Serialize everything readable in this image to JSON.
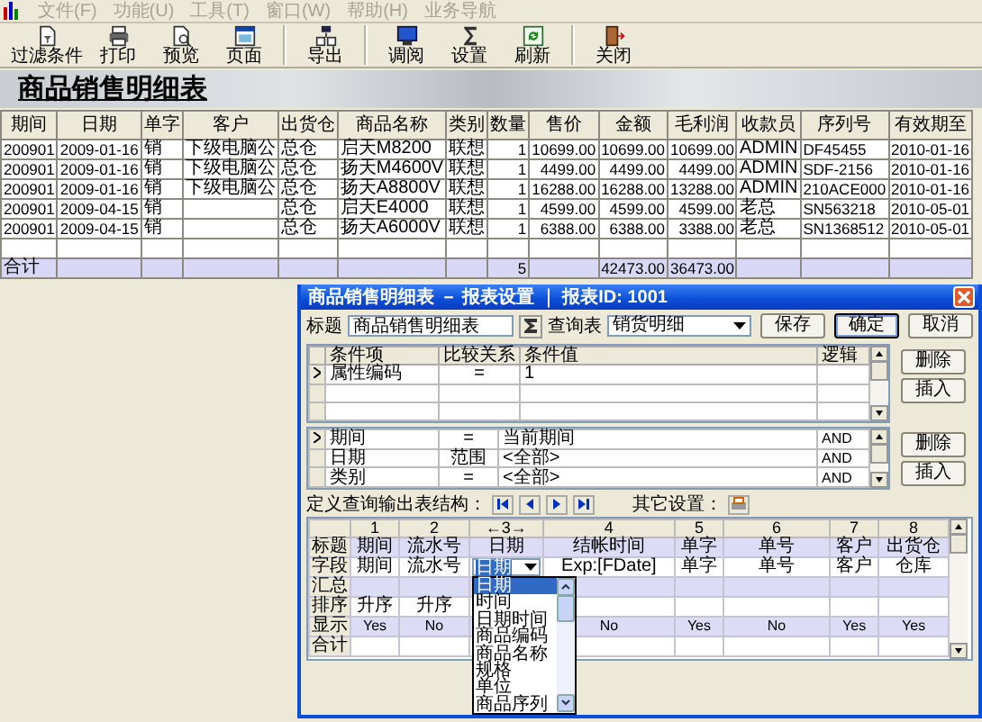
{
  "menu": [
    {
      "label": "文件(F)",
      "disabled": true
    },
    {
      "label": "功能(U)",
      "disabled": true
    },
    {
      "label": "工具(T)",
      "disabled": true
    },
    {
      "label": "窗口(W)",
      "disabled": true
    },
    {
      "label": "帮助(H)",
      "disabled": true
    },
    {
      "label": "业务导航",
      "disabled": true
    }
  ],
  "toolbar": [
    [
      {
        "label": "过滤条件",
        "kind": "filter"
      },
      {
        "label": "打印",
        "kind": "print"
      },
      {
        "label": "预览",
        "kind": "preview"
      },
      {
        "label": "页面",
        "kind": "page"
      }
    ],
    [
      {
        "label": "导出",
        "kind": "export"
      }
    ],
    [
      {
        "label": "调阅",
        "kind": "browse"
      },
      {
        "label": "设置",
        "kind": "settings"
      },
      {
        "label": "刷新",
        "kind": "refresh"
      }
    ],
    [
      {
        "label": "关闭",
        "kind": "close"
      }
    ]
  ],
  "banner": {
    "title": "商品销售明细表"
  },
  "report_table": {
    "columns": [
      "期间",
      "日期",
      "单字",
      "客户",
      "出货仓",
      "商品名称",
      "类别",
      "数量",
      "售价",
      "金额",
      "毛利润",
      "收款员",
      "序列号",
      "有效期至"
    ],
    "rows": [
      [
        "200901",
        "2009-01-16",
        "销",
        "下级电脑公",
        "总仓",
        "启天M8200",
        "联想",
        "1",
        "10699.00",
        "10699.00",
        "10699.00",
        "ADMIN",
        "DF45455",
        "2010-01-16"
      ],
      [
        "200901",
        "2009-01-16",
        "销",
        "下级电脑公",
        "总仓",
        "扬天M4600V",
        "联想",
        "1",
        "4499.00",
        "4499.00",
        "4499.00",
        "ADMIN",
        "SDF-2156",
        "2010-01-16"
      ],
      [
        "200901",
        "2009-01-16",
        "销",
        "下级电脑公",
        "总仓",
        "扬天A8800V",
        "联想",
        "1",
        "16288.00",
        "16288.00",
        "13288.00",
        "ADMIN",
        "210ACE000",
        "2010-01-16"
      ],
      [
        "200901",
        "2009-04-15",
        "销",
        "",
        "总仓",
        "启天E4000",
        "联想",
        "1",
        "4599.00",
        "4599.00",
        "4599.00",
        "老总",
        "SN563218",
        "2010-05-01"
      ],
      [
        "200901",
        "2009-04-15",
        "销",
        "",
        "总仓",
        "扬天A6000V",
        "联想",
        "1",
        "6388.00",
        "6388.00",
        "3388.00",
        "老总",
        "SN1368512",
        "2010-05-01"
      ]
    ],
    "total": {
      "label": "合计",
      "quantity": "5",
      "amount": "42473.00",
      "gross_profit": "36473.00"
    }
  },
  "dialog": {
    "title": "商品销售明细表 － 报表设置 ｜ 报表ID: 1001",
    "title_label": "标题",
    "title_value": "商品销售明细表",
    "query_label": "查询表",
    "query_value": "销货明细",
    "buttons": [
      {
        "label": "保存",
        "default": false
      },
      {
        "label": "确定",
        "default": true
      },
      {
        "label": "取消",
        "default": false
      }
    ],
    "filter_grid": {
      "columns": [
        "条件项",
        "比较关系",
        "条件值",
        "逻辑"
      ],
      "rows": [
        {
          "current": true,
          "cells": [
            "属性编码",
            "=",
            "1",
            ""
          ]
        }
      ],
      "buttons": [
        "删除",
        "插入"
      ]
    },
    "condition_grid": {
      "rows": [
        {
          "current": true,
          "cells": [
            "期间",
            "=",
            "当前期间",
            "AND"
          ]
        },
        {
          "current": false,
          "cells": [
            "日期",
            "范围",
            "<全部>",
            "AND"
          ]
        },
        {
          "current": false,
          "cells": [
            "类别",
            "=",
            "<全部>",
            "AND"
          ]
        }
      ],
      "buttons": [
        "删除",
        "插入"
      ]
    },
    "output_label": "定义查询输出表结构：",
    "other_label": "其它设置：",
    "output_grid": {
      "row_labels": [
        "标题",
        "字段",
        "汇总",
        "排序",
        "显示",
        "合计"
      ],
      "columns": [
        {
          "header": "1",
          "cells": [
            "期间",
            "期间",
            "",
            "升序",
            "Yes"
          ]
        },
        {
          "header": "2",
          "cells": [
            "流水号",
            "流水号",
            "",
            "升序",
            "No"
          ]
        },
        {
          "header": "←3→",
          "cells": [
            "日期",
            "",
            "",
            "",
            ""
          ],
          "dropdown": {
            "value": "日期",
            "options": [
              {
                "label": "日期",
                "selected": true
              },
              {
                "label": "时间",
                "selected": false
              },
              {
                "label": "日期时间",
                "selected": false
              },
              {
                "label": "商品编码",
                "selected": false
              },
              {
                "label": "商品名称",
                "selected": false
              },
              {
                "label": "规格",
                "selected": false
              },
              {
                "label": "单位",
                "selected": false
              },
              {
                "label": "商品序列",
                "selected": false
              }
            ]
          }
        },
        {
          "header": "4",
          "cells": [
            "结帐时间",
            "Exp:[FDate]",
            "",
            "",
            "No"
          ]
        },
        {
          "header": "5",
          "cells": [
            "单字",
            "单字",
            "",
            "",
            "Yes"
          ]
        },
        {
          "header": "6",
          "cells": [
            "单号",
            "单号",
            "",
            "",
            "No"
          ]
        },
        {
          "header": "7",
          "cells": [
            "客户",
            "客户",
            "",
            "",
            "Yes"
          ]
        },
        {
          "header": "8",
          "cells": [
            "出货仓",
            "仓库",
            "",
            "",
            "Yes"
          ]
        }
      ]
    }
  }
}
